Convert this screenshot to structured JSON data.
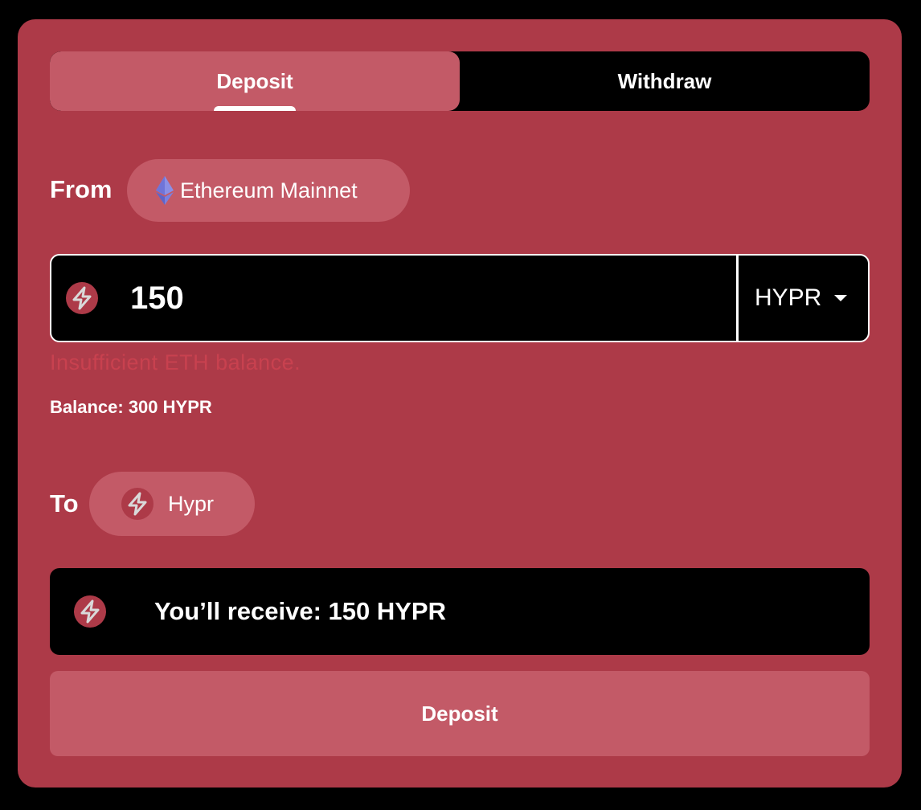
{
  "colors": {
    "card_bg": "#ad3a48",
    "accent_light": "#c35a67",
    "error": "#c8414f",
    "panel_bg": "#000000",
    "text": "#ffffff"
  },
  "tabs": [
    {
      "label": "Deposit",
      "active": true
    },
    {
      "label": "Withdraw",
      "active": false
    }
  ],
  "from": {
    "label": "From",
    "network": "Ethereum Mainnet",
    "icon": "ethereum-icon"
  },
  "amount": {
    "value": "150",
    "token": "HYPR",
    "icon": "hypr-token-icon"
  },
  "error": "Insufficient ETH balance.",
  "balance": "Balance: 300 HYPR",
  "to": {
    "label": "To",
    "network": "Hypr",
    "icon": "hypr-token-icon"
  },
  "receive": "You’ll receive: 150 HYPR",
  "submit_label": "Deposit"
}
